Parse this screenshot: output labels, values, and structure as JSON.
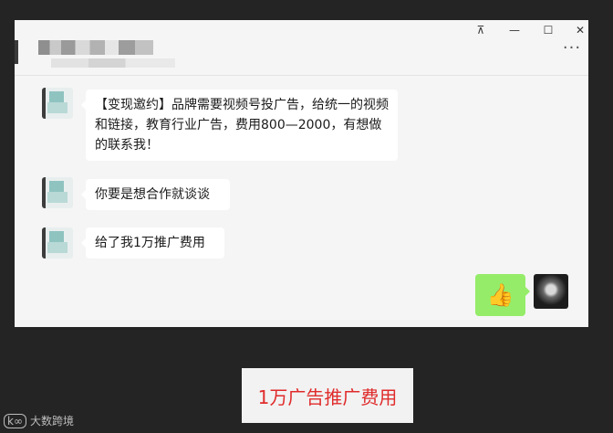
{
  "window_controls": {
    "pin": "⊼",
    "minimize": "—",
    "maximize": "☐",
    "close": "✕"
  },
  "header": {
    "more": "···"
  },
  "messages": [
    {
      "text": "【变现邀约】品牌需要视频号投广告，给统一的视频和链接，教育行业广告，费用800—2000，有想做的联系我！"
    },
    {
      "text": "你要是想合作就谈谈"
    },
    {
      "text": "给了我1万推广费用"
    }
  ],
  "my_message": {
    "emoji": "👍"
  },
  "caption": "1万广告推广费用",
  "watermark": {
    "logo": "k∞",
    "text": "大数跨境"
  }
}
